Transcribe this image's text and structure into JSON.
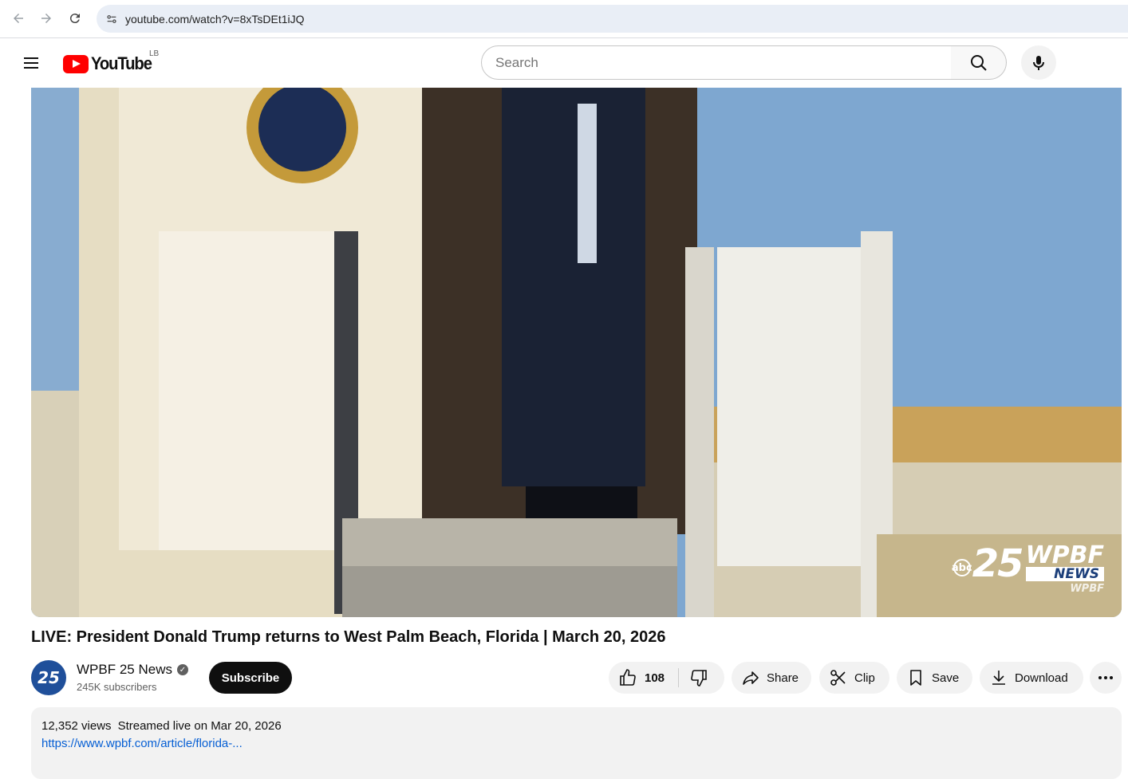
{
  "browser": {
    "url": "youtube.com/watch?v=8xTsDEt1iJQ"
  },
  "masthead": {
    "logo_text": "YouTube",
    "region": "LB",
    "search_placeholder": "Search"
  },
  "player": {
    "watermark": {
      "network": "abc",
      "channel_number": "25",
      "station": "WPBF",
      "news_label": "NEWS",
      "sub_label": "WPBF"
    }
  },
  "video": {
    "title": "LIVE: President Donald Trump returns to West Palm Beach, Florida | March 20, 2026"
  },
  "channel": {
    "avatar_text": "25",
    "name": "WPBF 25 News",
    "subscribers": "245K subscribers",
    "subscribe_label": "Subscribe"
  },
  "actions": {
    "like_count": "108",
    "share_label": "Share",
    "clip_label": "Clip",
    "save_label": "Save",
    "download_label": "Download"
  },
  "description": {
    "views": "12,352 views",
    "streamed": "Streamed live on Mar 20, 2026",
    "link": "https://www.wpbf.com/article/florida-..."
  },
  "colors": {
    "brand_red": "#ff0000",
    "link_blue": "#065fd4",
    "subscribe_bg": "#0f0f0f"
  }
}
